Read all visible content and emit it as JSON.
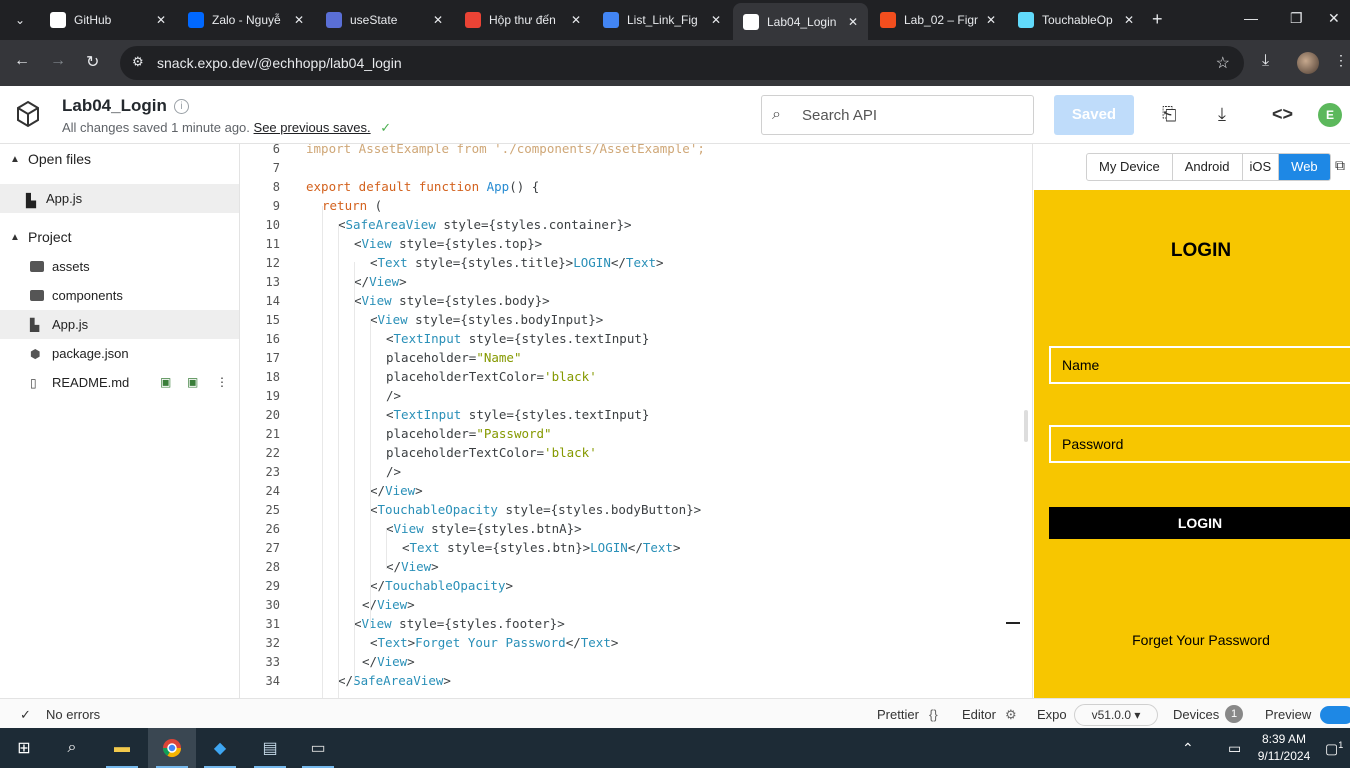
{
  "browser": {
    "tabs": [
      {
        "title": "GitHub",
        "color": "#ffffff",
        "icon": "github-icon"
      },
      {
        "title": "Zalo - Nguyễ",
        "color": "#0068ff",
        "icon": "zalo-icon"
      },
      {
        "title": "useState",
        "color": "#5a6fd6",
        "icon": "react-icon"
      },
      {
        "title": "Hộp thư đến",
        "color": "#ea4335",
        "icon": "gmail-icon"
      },
      {
        "title": "List_Link_Fig",
        "color": "#4285f4",
        "icon": "docs-icon"
      },
      {
        "title": "Lab04_Login",
        "color": "#ffffff",
        "icon": "snack-icon"
      },
      {
        "title": "Lab_02 – Figr",
        "color": "#f24e1e",
        "icon": "figma-icon"
      },
      {
        "title": "TouchableOp",
        "color": "#61dafb",
        "icon": "react-icon"
      }
    ],
    "active_tab": 5,
    "url": "snack.expo.dev/@echhopp/lab04_login"
  },
  "snack": {
    "project_title": "Lab04_Login",
    "save_status": "All changes saved 1 minute ago.",
    "previous_saves_link": "See previous saves.",
    "search_placeholder": "Search API",
    "saved_button": "Saved",
    "user_initial": "E"
  },
  "sidebar": {
    "open_files_label": "Open files",
    "open_files": [
      "App.js"
    ],
    "project_label": "Project",
    "project_files": [
      {
        "name": "assets",
        "type": "folder"
      },
      {
        "name": "components",
        "type": "folder"
      },
      {
        "name": "App.js",
        "type": "file",
        "selected": true
      },
      {
        "name": "package.json",
        "type": "package"
      },
      {
        "name": "README.md",
        "type": "file"
      }
    ]
  },
  "editor": {
    "lines": [
      {
        "n": "6",
        "indent": 0,
        "html": "<span class='kw dim'>import</span><span class='dim'> AssetExample </span><span class='kw dim'>from</span><span class='dim'> './components/AssetExample';</span>"
      },
      {
        "n": "7",
        "indent": 0,
        "html": ""
      },
      {
        "n": "8",
        "indent": 0,
        "html": "<span class='kw'>export default function</span> <span class='fn'>App</span>() {"
      },
      {
        "n": "9",
        "indent": 1,
        "html": "<span class='kw'>return</span> ("
      },
      {
        "n": "10",
        "indent": 2,
        "html": "&lt;<span class='tg'>SafeAreaView</span> style={styles.container}&gt;"
      },
      {
        "n": "11",
        "indent": 3,
        "html": "&lt;<span class='tg'>View</span> style={styles.top}&gt;"
      },
      {
        "n": "12",
        "indent": 4,
        "html": "&lt;<span class='tg'>Text</span> style={styles.title}&gt;<span class='tg'>LOGIN</span>&lt;/<span class='tg'>Text</span>&gt;"
      },
      {
        "n": "13",
        "indent": 3,
        "html": "&lt;/<span class='tg'>View</span>&gt;"
      },
      {
        "n": "14",
        "indent": 3,
        "html": "&lt;<span class='tg'>View</span> style={styles.body}&gt;"
      },
      {
        "n": "15",
        "indent": 4,
        "html": "&lt;<span class='tg'>View</span> style={styles.bodyInput}&gt;"
      },
      {
        "n": "16",
        "indent": 5,
        "html": "&lt;<span class='tg'>TextInput</span> style={styles.textInput}"
      },
      {
        "n": "17",
        "indent": 5,
        "html": "placeholder=<span class='st'>\"Name\"</span>"
      },
      {
        "n": "18",
        "indent": 5,
        "html": "placeholderTextColor=<span class='st'>'black'</span>"
      },
      {
        "n": "19",
        "indent": 5,
        "html": "/&gt;"
      },
      {
        "n": "20",
        "indent": 5,
        "html": "&lt;<span class='tg'>TextInput</span> style={styles.textInput}"
      },
      {
        "n": "21",
        "indent": 5,
        "html": "placeholder=<span class='st'>\"Password\"</span>"
      },
      {
        "n": "22",
        "indent": 5,
        "html": "placeholderTextColor=<span class='st'>'black'</span>"
      },
      {
        "n": "23",
        "indent": 5,
        "html": "/&gt;"
      },
      {
        "n": "24",
        "indent": 4,
        "html": "&lt;/<span class='tg'>View</span>&gt;"
      },
      {
        "n": "25",
        "indent": 4,
        "html": "&lt;<span class='tg'>TouchableOpacity</span> style={styles.bodyButton}&gt;"
      },
      {
        "n": "26",
        "indent": 5,
        "html": "&lt;<span class='tg'>View</span> style={styles.btnA}&gt;"
      },
      {
        "n": "27",
        "indent": 6,
        "html": "&lt;<span class='tg'>Text</span> style={styles.btn}&gt;<span class='tg'>LOGIN</span>&lt;/<span class='tg'>Text</span>&gt;"
      },
      {
        "n": "28",
        "indent": 5,
        "html": "&lt;/<span class='tg'>View</span>&gt;"
      },
      {
        "n": "29",
        "indent": 4,
        "html": "&lt;/<span class='tg'>TouchableOpacity</span>&gt;"
      },
      {
        "n": "30",
        "indent": 3.5,
        "html": "&lt;/<span class='tg'>View</span>&gt;"
      },
      {
        "n": "31",
        "indent": 3,
        "html": "&lt;<span class='tg'>View</span> style={styles.footer}&gt;"
      },
      {
        "n": "32",
        "indent": 4,
        "html": "&lt;<span class='tg'>Text</span>&gt;<span class='tg'>Forget Your Password</span>&lt;/<span class='tg'>Text</span>&gt;"
      },
      {
        "n": "33",
        "indent": 3.5,
        "html": "&lt;/<span class='tg'>View</span>&gt;"
      },
      {
        "n": "34",
        "indent": 2,
        "html": "&lt;/<span class='tg'>SafeAreaView</span>&gt;"
      }
    ]
  },
  "preview": {
    "device_tabs": [
      "My Device",
      "Android",
      "iOS",
      "Web"
    ],
    "active_device": "Web",
    "app": {
      "title": "LOGIN",
      "name_placeholder": "Name",
      "password_placeholder": "Password",
      "login_button": "LOGIN",
      "forget_text": "Forget Your Password",
      "background": "#f7c600"
    }
  },
  "statusbar": {
    "errors": "No errors",
    "prettier": "Prettier",
    "editor": "Editor",
    "expo": "Expo",
    "version": "v51.0.0",
    "devices": "Devices",
    "devices_count": "1",
    "preview": "Preview"
  },
  "taskbar": {
    "time": "8:39 AM",
    "date": "9/11/2024",
    "notifications": "1"
  }
}
